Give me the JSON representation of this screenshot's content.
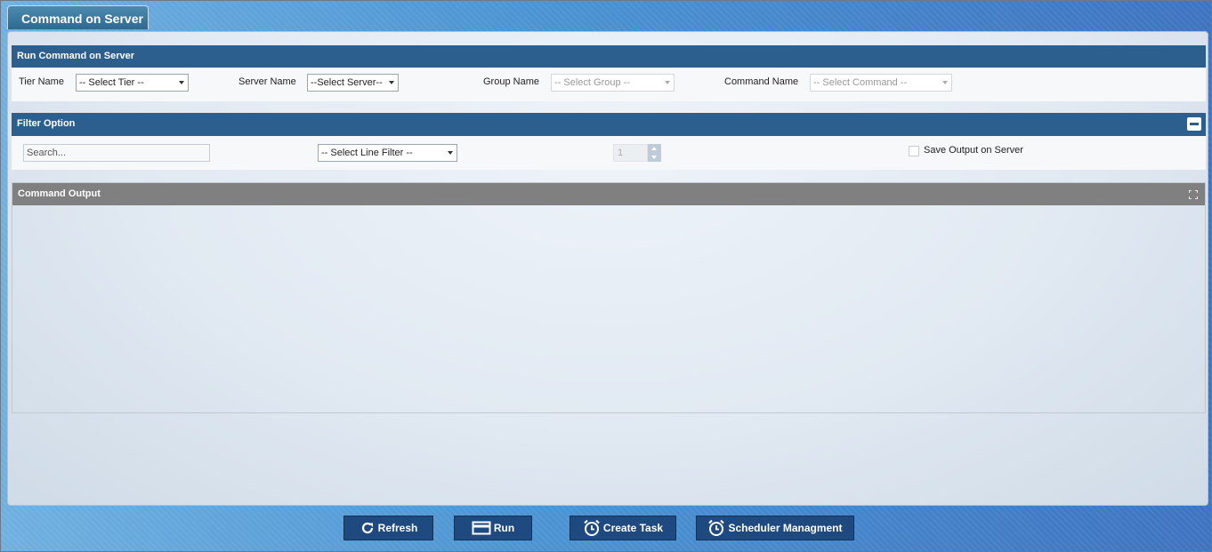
{
  "tab": {
    "title": "Command on Server"
  },
  "run_section": {
    "title": "Run Command on Server",
    "tier_label": "Tier Name",
    "tier_value": "-- Select Tier --",
    "server_label": "Server Name",
    "server_value": "--Select Server--",
    "group_label": "Group Name",
    "group_value": "-- Select Group --",
    "command_label": "Command Name",
    "command_value": "-- Select Command --"
  },
  "filter_section": {
    "title": "Filter Option",
    "search_placeholder": "Search...",
    "line_filter_value": "-- Select Line Filter --",
    "line_count": "1",
    "save_output_label": "Save Output on Server",
    "save_output_checked": false
  },
  "output_section": {
    "title": "Command Output"
  },
  "buttons": {
    "refresh": "Refresh",
    "run": "Run",
    "create_task": "Create Task",
    "scheduler": "Scheduler Managment"
  },
  "colors": {
    "header_blue": "#2d5f8e",
    "output_header_gray": "#808080",
    "button_blue": "#1f4a80"
  }
}
